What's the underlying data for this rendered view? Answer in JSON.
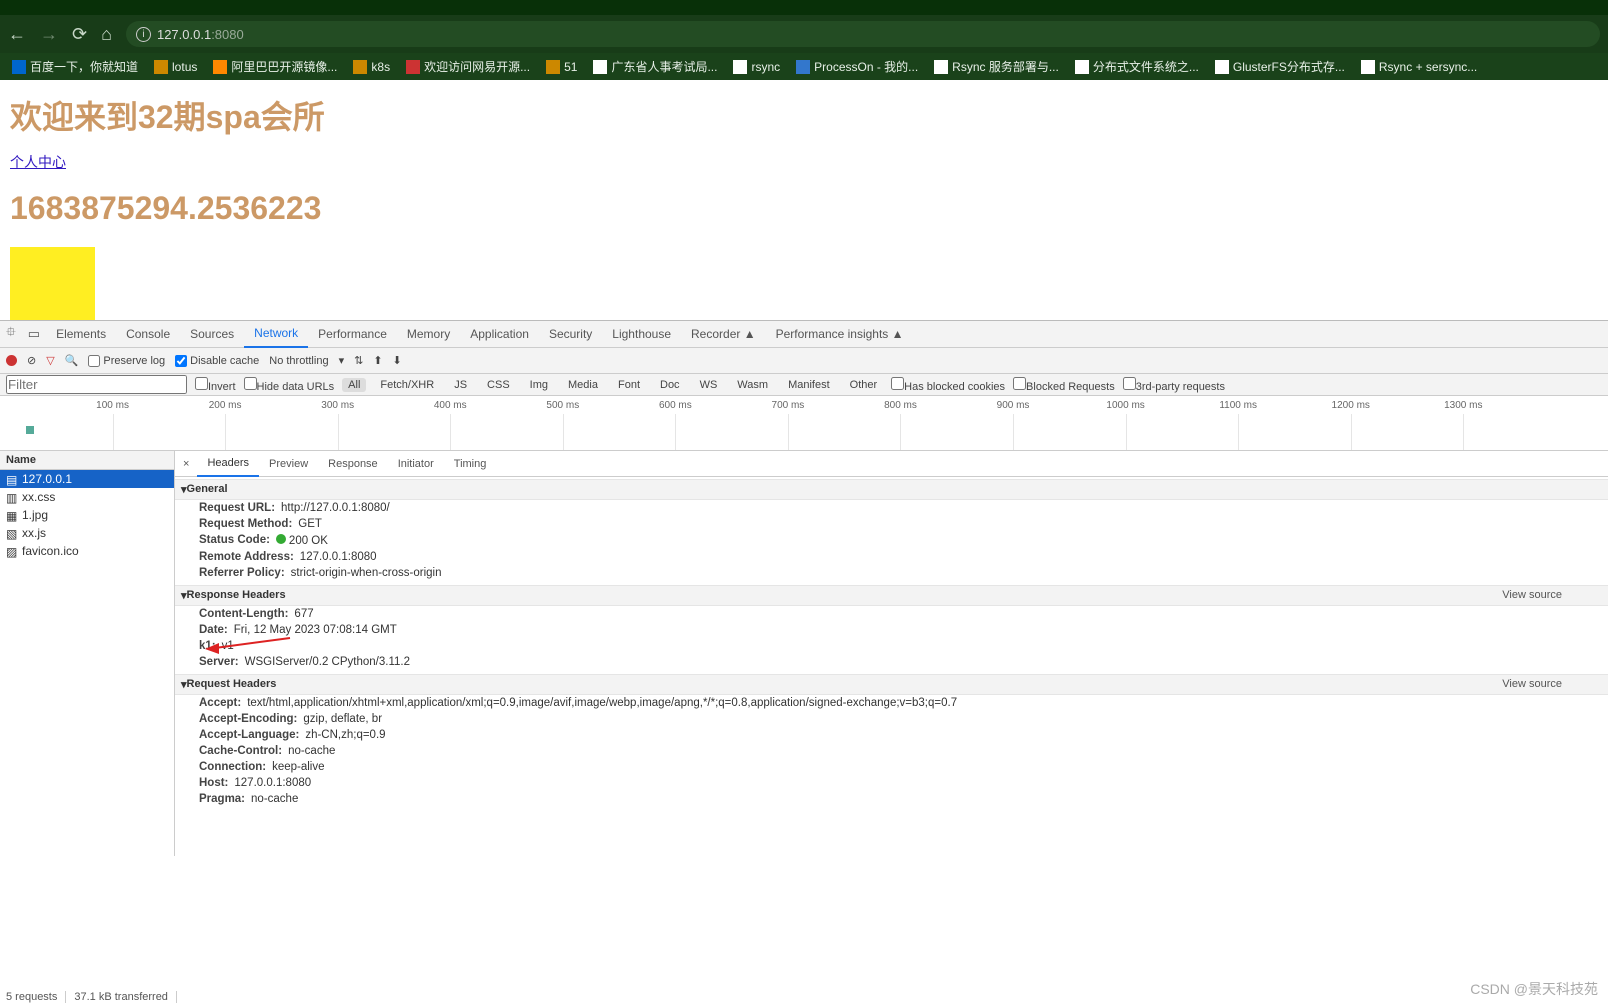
{
  "browser": {
    "url_prefix": "127.0.0.1",
    "url_port": ":8080"
  },
  "bookmarks": [
    {
      "label": "百度一下，你就知道",
      "cls": "b"
    },
    {
      "label": "lotus",
      "cls": "g"
    },
    {
      "label": "阿里巴巴开源镜像...",
      "cls": "o"
    },
    {
      "label": "k8s",
      "cls": ""
    },
    {
      "label": "欢迎访问网易开源...",
      "cls": "r"
    },
    {
      "label": "51",
      "cls": ""
    },
    {
      "label": "广东省人事考试局...",
      "cls": "w"
    },
    {
      "label": "rsync",
      "cls": "w"
    },
    {
      "label": "ProcessOn - 我的...",
      "cls": "on"
    },
    {
      "label": "Rsync 服务部署与...",
      "cls": "w"
    },
    {
      "label": "分布式文件系统之...",
      "cls": "w"
    },
    {
      "label": "GlusterFS分布式存...",
      "cls": "w"
    },
    {
      "label": "Rsync + sersync...",
      "cls": "w"
    }
  ],
  "page": {
    "title": "欢迎来到32期spa会所",
    "link": "个人中心",
    "ts": "1683875294.2536223"
  },
  "devtabs": [
    "Elements",
    "Console",
    "Sources",
    "Network",
    "Performance",
    "Memory",
    "Application",
    "Security",
    "Lighthouse",
    "Recorder ▲",
    "Performance insights ▲"
  ],
  "toolbar": {
    "preserve": "Preserve log",
    "disable": "Disable cache",
    "throttle": "No throttling"
  },
  "filter": {
    "placeholder": "Filter",
    "invert": "Invert",
    "hide": "Hide data URLs",
    "types": [
      "All",
      "Fetch/XHR",
      "JS",
      "CSS",
      "Img",
      "Media",
      "Font",
      "Doc",
      "WS",
      "Wasm",
      "Manifest",
      "Other"
    ],
    "blocked": "Has blocked cookies",
    "blockedreq": "Blocked Requests",
    "third": "3rd-party requests"
  },
  "timeline": [
    "100 ms",
    "200 ms",
    "300 ms",
    "400 ms",
    "500 ms",
    "600 ms",
    "700 ms",
    "800 ms",
    "900 ms",
    "1000 ms",
    "1100 ms",
    "1200 ms",
    "1300 ms"
  ],
  "requests": {
    "header": "Name",
    "rows": [
      "127.0.0.1",
      "xx.css",
      "1.jpg",
      "xx.js",
      "favicon.ico"
    ]
  },
  "detail_tabs": [
    "Headers",
    "Preview",
    "Response",
    "Initiator",
    "Timing"
  ],
  "general": {
    "title": "General",
    "url_k": "Request URL:",
    "url_v": "http://127.0.0.1:8080/",
    "method_k": "Request Method:",
    "method_v": "GET",
    "status_k": "Status Code:",
    "status_v": "200 OK",
    "remote_k": "Remote Address:",
    "remote_v": "127.0.0.1:8080",
    "ref_k": "Referrer Policy:",
    "ref_v": "strict-origin-when-cross-origin"
  },
  "resp": {
    "title": "Response Headers",
    "vs": "View source",
    "cl_k": "Content-Length:",
    "cl_v": "677",
    "date_k": "Date:",
    "date_v": "Fri, 12 May 2023 07:08:14 GMT",
    "k1_k": "k1:",
    "k1_v": "v1",
    "srv_k": "Server:",
    "srv_v": "WSGIServer/0.2 CPython/3.11.2"
  },
  "req": {
    "title": "Request Headers",
    "vs": "View source",
    "acc_k": "Accept:",
    "acc_v": "text/html,application/xhtml+xml,application/xml;q=0.9,image/avif,image/webp,image/apng,*/*;q=0.8,application/signed-exchange;v=b3;q=0.7",
    "enc_k": "Accept-Encoding:",
    "enc_v": "gzip, deflate, br",
    "lang_k": "Accept-Language:",
    "lang_v": "zh-CN,zh;q=0.9",
    "cc_k": "Cache-Control:",
    "cc_v": "no-cache",
    "conn_k": "Connection:",
    "conn_v": "keep-alive",
    "host_k": "Host:",
    "host_v": "127.0.0.1:8080",
    "prag_k": "Pragma:",
    "prag_v": "no-cache"
  },
  "footer": {
    "reqs": "5 requests",
    "xfer": "37.1 kB transferred"
  },
  "wm": "CSDN @景天科技苑"
}
